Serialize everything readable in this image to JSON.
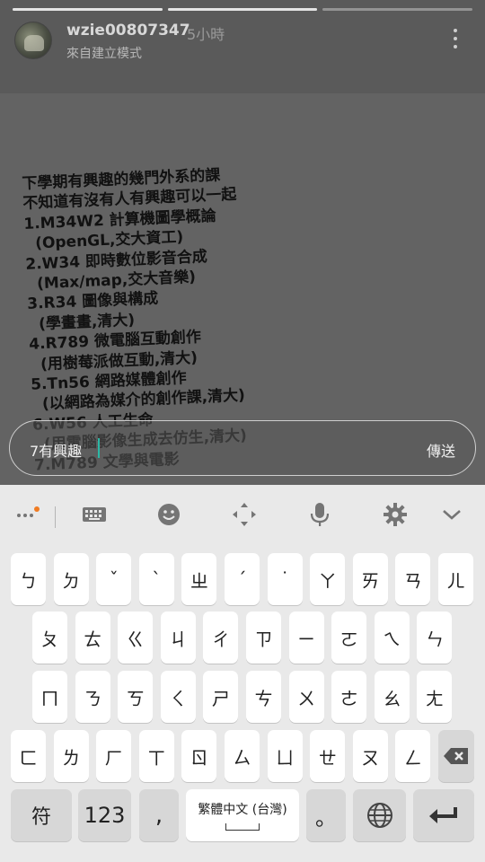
{
  "header": {
    "username": "wzie00807347",
    "time": "5小時",
    "subtitle": "來自建立模式",
    "story_progress": [
      1.0,
      1.0,
      0.0
    ]
  },
  "story": {
    "lines": [
      "下學期有興趣的幾門外系的課",
      "不知道有沒有人有興趣可以一起",
      "",
      "1.M34W2 計算機圖學概論",
      "  (OpenGL,交大資工)",
      "2.W34 即時數位影音合成",
      "  (Max/map,交大音樂)",
      "3.R34 圖像與構成",
      "  (學畫畫,清大)",
      "4.R789 微電腦互動創作",
      "  (用樹莓派做互動,清大)",
      "5.Tn56 網路媒體創作",
      "  (以網路為媒介的創作課,清大)",
      "6.W56 人工生命",
      "  (用電腦影像生成去仿生,清大)",
      "7.M789 文學與電影"
    ]
  },
  "reply": {
    "value": "7有興趣",
    "send_label": "傳送"
  },
  "keyboard": {
    "toolbar_icons": [
      "more-dots-icon",
      "keyboard-icon",
      "emoji-icon",
      "cursor-move-icon",
      "mic-icon",
      "settings-icon",
      "collapse-chevron-icon"
    ],
    "row1": [
      "ㄅ",
      "ㄉ",
      "ˇ",
      "ˋ",
      "ㄓ",
      "ˊ",
      "˙",
      "ㄚ",
      "ㄞ",
      "ㄢ",
      "ㄦ"
    ],
    "row2": [
      "ㄆ",
      "ㄊ",
      "ㄍ",
      "ㄐ",
      "ㄔ",
      "ㄗ",
      "ㄧ",
      "ㄛ",
      "ㄟ",
      "ㄣ"
    ],
    "row3": [
      "ㄇ",
      "ㄋ",
      "ㄎ",
      "ㄑ",
      "ㄕ",
      "ㄘ",
      "ㄨ",
      "ㄜ",
      "ㄠ",
      "ㄤ"
    ],
    "row4": [
      "ㄈ",
      "ㄌ",
      "ㄏ",
      "ㄒ",
      "ㄖ",
      "ㄙ",
      "ㄩ",
      "ㄝ",
      "ㄡ",
      "ㄥ"
    ],
    "symbols_label": "符",
    "numbers_label": "123",
    "comma_label": ",",
    "space_label": "繁體中文 (台灣)",
    "period_label": "。"
  },
  "colors": {
    "accent_cursor": "#2bb8a6",
    "notification_dot": "#f07b22"
  }
}
